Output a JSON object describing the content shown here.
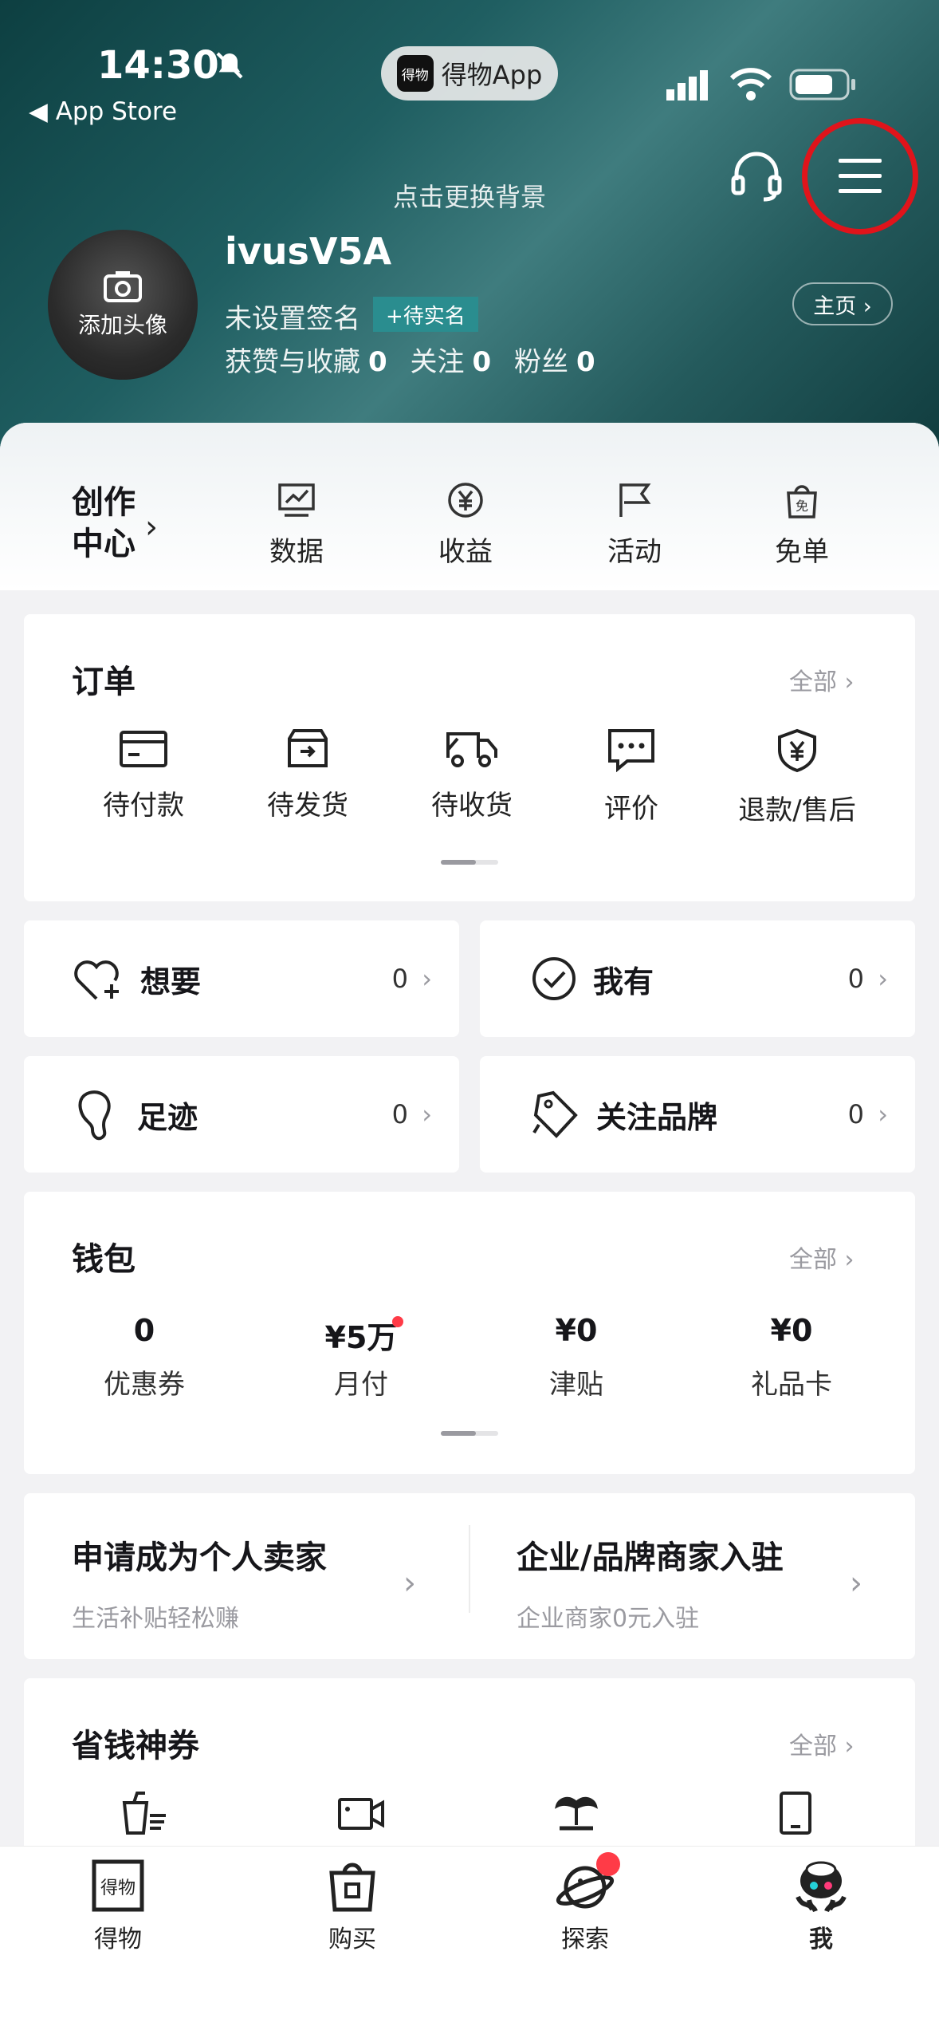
{
  "status_bar": {
    "time": "14:30",
    "back_label": "◀ App Store",
    "app_pill": "得物App",
    "app_pill_logo": "得物"
  },
  "header": {
    "bg_hint": "点击更换背景",
    "avatar_label": "添加头像",
    "username": "ivusV5A",
    "signature": "未设置签名",
    "verify_tag": "+待实名",
    "homepage_btn": "主页 ›",
    "stats": [
      {
        "label": "获赞与收藏",
        "value": "0"
      },
      {
        "label": "关注",
        "value": "0"
      },
      {
        "label": "粉丝",
        "value": "0"
      }
    ]
  },
  "creator": {
    "title_line1": "创作",
    "title_line2": "中心",
    "items": [
      {
        "label": "数据",
        "icon": "chart-icon"
      },
      {
        "label": "收益",
        "icon": "yuan-icon"
      },
      {
        "label": "活动",
        "icon": "flag-icon"
      },
      {
        "label": "免单",
        "icon": "bag-icon"
      }
    ]
  },
  "orders": {
    "title": "订单",
    "all": "全部",
    "items": [
      {
        "label": "待付款",
        "icon": "card-icon"
      },
      {
        "label": "待发货",
        "icon": "box-icon"
      },
      {
        "label": "待收货",
        "icon": "truck-icon"
      },
      {
        "label": "评价",
        "icon": "chat-icon"
      },
      {
        "label": "退款/售后",
        "icon": "shield-icon"
      }
    ]
  },
  "quick": [
    {
      "label": "想要",
      "count": "0",
      "icon": "heart-plus-icon"
    },
    {
      "label": "我有",
      "count": "0",
      "icon": "check-circle-icon"
    },
    {
      "label": "足迹",
      "count": "0",
      "icon": "footprint-icon"
    },
    {
      "label": "关注品牌",
      "count": "0",
      "icon": "tag-icon"
    }
  ],
  "wallet": {
    "title": "钱包",
    "all": "全部",
    "items": [
      {
        "value": "0",
        "label": "优惠券"
      },
      {
        "value": "¥5万",
        "label": "月付"
      },
      {
        "value": "¥0",
        "label": "津贴"
      },
      {
        "value": "¥0",
        "label": "礼品卡"
      }
    ]
  },
  "sellers": [
    {
      "title": "申请成为个人卖家",
      "sub": "生活补贴轻松赚"
    },
    {
      "title": "企业/品牌商家入驻",
      "sub": "企业商家0元入驻"
    }
  ],
  "coupons": {
    "title": "省钱神券",
    "all": "全部",
    "icons": [
      "drink-icon",
      "video-icon",
      "island-icon",
      "phone-icon"
    ]
  },
  "tabs": [
    {
      "label": "得物",
      "icon": "dewu-logo-icon"
    },
    {
      "label": "购买",
      "icon": "shopping-bag-icon"
    },
    {
      "label": "探索",
      "icon": "planet-icon"
    },
    {
      "label": "我",
      "icon": "avatar-mascot-icon"
    }
  ],
  "colors": {
    "accent_red": "#e0141b",
    "teal": "#1f5e61",
    "verify_bg": "#2a8d8f",
    "badge_red": "#ff3b47"
  }
}
